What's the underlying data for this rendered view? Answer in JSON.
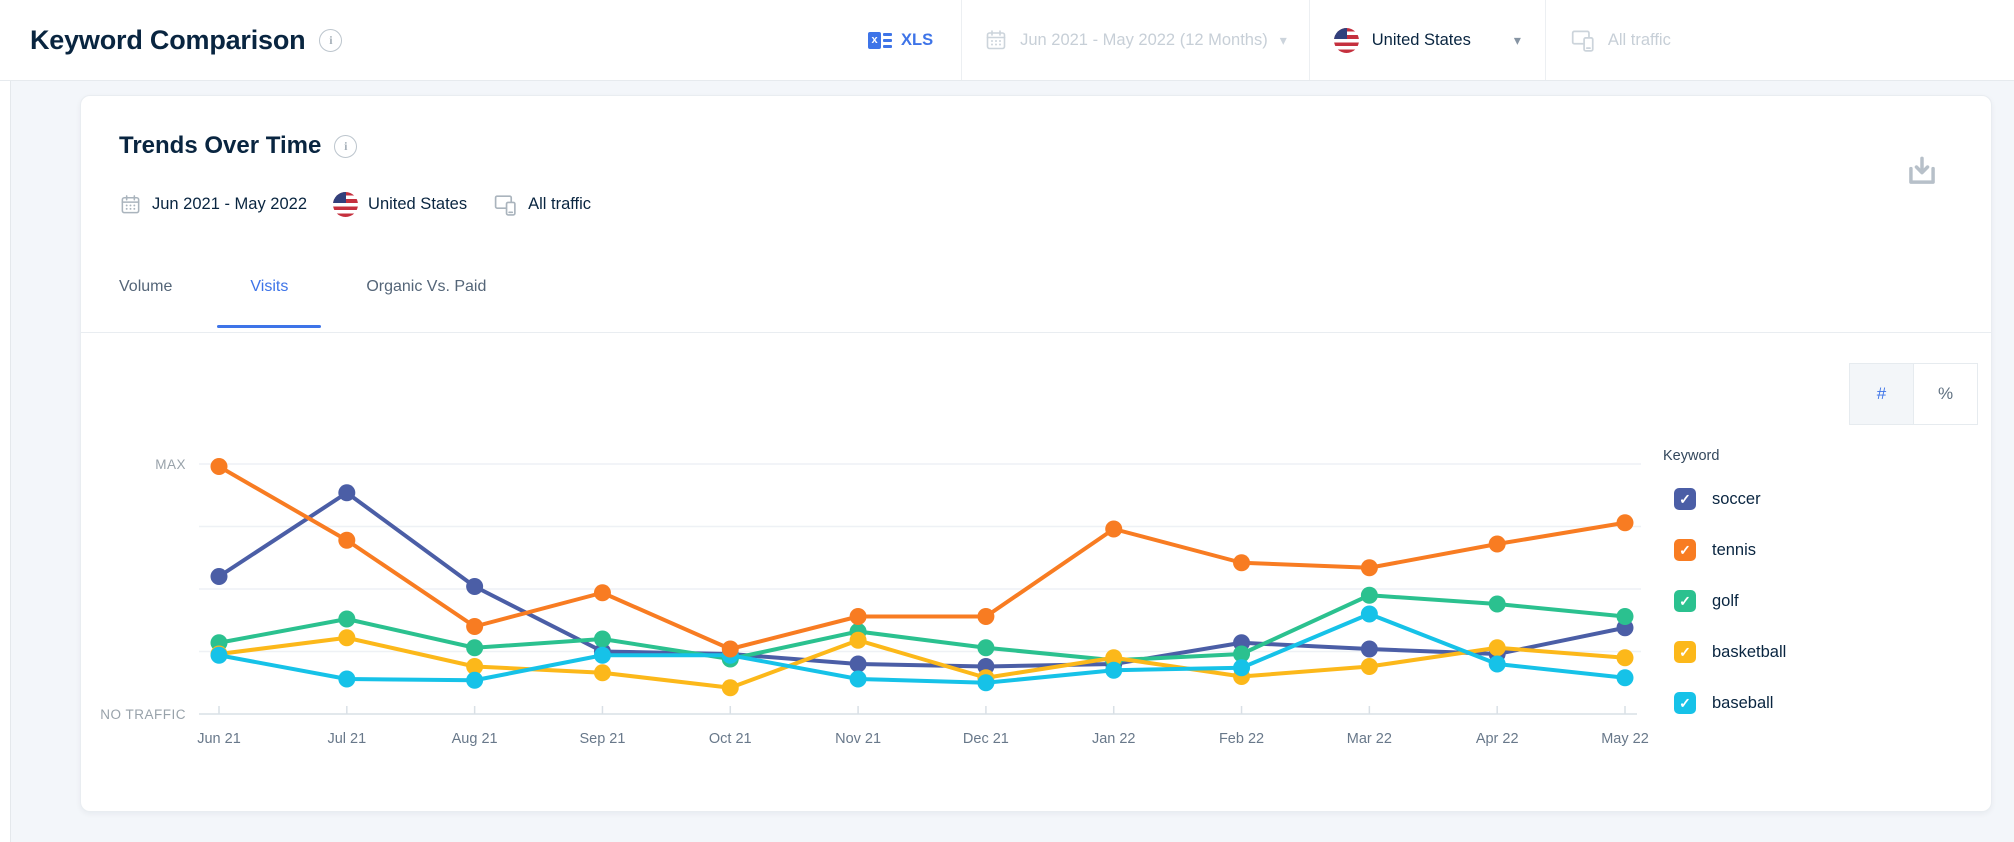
{
  "header": {
    "title": "Keyword Comparison",
    "export_label": "XLS",
    "date_range": "Jun 2021 - May 2022 (12 Months)",
    "country": "United States",
    "traffic": "All traffic"
  },
  "card": {
    "title": "Trends Over Time",
    "date_range": "Jun 2021 - May 2022",
    "country": "United States",
    "traffic": "All traffic",
    "tabs": [
      {
        "label": "Volume",
        "active": false
      },
      {
        "label": "Visits",
        "active": true
      },
      {
        "label": "Organic Vs. Paid",
        "active": false
      }
    ],
    "unit_toggle": {
      "options": [
        "#",
        "%"
      ],
      "selected": "#"
    }
  },
  "chart_data": {
    "type": "line",
    "legend_title": "Keyword",
    "legend_position": "right",
    "grid": true,
    "y_axis": {
      "max_label": "MAX",
      "min_label": "NO TRAFFIC",
      "range": [
        0,
        1
      ],
      "gridline_fractions": [
        1,
        0.75,
        0.5,
        0.25
      ]
    },
    "categories": [
      "Jun 21",
      "Jul 21",
      "Aug 21",
      "Sep 21",
      "Oct 21",
      "Nov 21",
      "Dec 21",
      "Jan 22",
      "Feb 22",
      "Mar 22",
      "Apr 22",
      "May 22"
    ],
    "series": [
      {
        "name": "soccer",
        "color": "#4b5ea6",
        "checked": true,
        "values": [
          0.55,
          0.885,
          0.51,
          0.25,
          0.24,
          0.2,
          0.19,
          0.2,
          0.285,
          0.26,
          0.24,
          0.345
        ]
      },
      {
        "name": "tennis",
        "color": "#f87c22",
        "checked": true,
        "values": [
          0.99,
          0.695,
          0.35,
          0.485,
          0.26,
          0.39,
          0.39,
          0.74,
          0.605,
          0.585,
          0.68,
          0.765
        ]
      },
      {
        "name": "golf",
        "color": "#2bc18f",
        "checked": true,
        "values": [
          0.285,
          0.38,
          0.265,
          0.3,
          0.22,
          0.33,
          0.265,
          0.215,
          0.24,
          0.475,
          0.44,
          0.39
        ]
      },
      {
        "name": "basketball",
        "color": "#fcb81a",
        "checked": true,
        "values": [
          0.24,
          0.305,
          0.19,
          0.165,
          0.105,
          0.295,
          0.145,
          0.225,
          0.15,
          0.19,
          0.265,
          0.225
        ]
      },
      {
        "name": "baseball",
        "color": "#16c2e8",
        "checked": true,
        "values": [
          0.235,
          0.14,
          0.135,
          0.235,
          0.235,
          0.14,
          0.125,
          0.175,
          0.185,
          0.4,
          0.2,
          0.145
        ]
      }
    ],
    "draw_order": [
      "soccer",
      "golf",
      "basketball",
      "baseball",
      "tennis"
    ]
  },
  "icons": {
    "info_letter": "i",
    "caret": "▾",
    "check": "✓"
  },
  "colors": {
    "accent_blue": "#3e74e8",
    "title_navy": "#092540",
    "disabled_gray": "#c7cfd7",
    "axis_label": "#68788a",
    "axis_line": "#d9e0e6",
    "gridline": "#eef1f5",
    "minmax_label": "#98a2aa"
  }
}
